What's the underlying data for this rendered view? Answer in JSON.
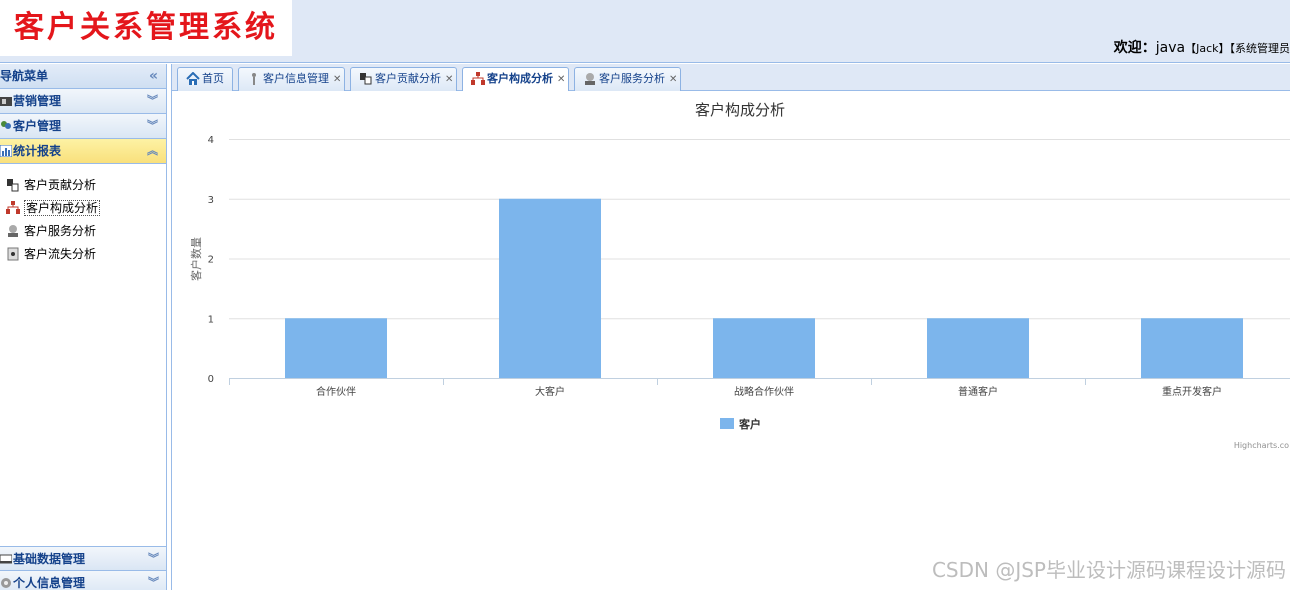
{
  "header": {
    "logo_text": "客户关系管理系统",
    "welcome_label": "欢迎：",
    "username": "java",
    "user_detail": "【Jack】【系统管理员"
  },
  "sidebar": {
    "title": "导航菜单",
    "collapse_glyph": "«",
    "groups_top": [
      {
        "label": "营销管理",
        "icon": "marketing-icon"
      },
      {
        "label": "客户管理",
        "icon": "customer-icon"
      }
    ],
    "active_group": {
      "label": "统计报表",
      "icon": "report-icon"
    },
    "items": [
      {
        "label": "客户贡献分析",
        "icon": "contribution-icon"
      },
      {
        "label": "客户构成分析",
        "icon": "composition-icon"
      },
      {
        "label": "客户服务分析",
        "icon": "service-icon"
      },
      {
        "label": "客户流失分析",
        "icon": "churn-icon"
      }
    ],
    "groups_bottom": [
      {
        "label": "基础数据管理",
        "icon": "basic-data-icon"
      },
      {
        "label": "个人信息管理",
        "icon": "personal-info-icon"
      }
    ]
  },
  "tabs": [
    {
      "label": "首页",
      "icon": "home-icon",
      "closable": false
    },
    {
      "label": "客户信息管理",
      "icon": "customer-info-icon",
      "closable": true
    },
    {
      "label": "客户贡献分析",
      "icon": "contribution-icon",
      "closable": true
    },
    {
      "label": "客户构成分析",
      "icon": "composition-icon",
      "closable": true,
      "active": true
    },
    {
      "label": "客户服务分析",
      "icon": "service-icon",
      "closable": true
    }
  ],
  "chart_data": {
    "type": "bar",
    "title": "客户构成分析",
    "categories": [
      "合作伙伴",
      "大客户",
      "战略合作伙伴",
      "普通客户",
      "重点开发客户"
    ],
    "series": [
      {
        "name": "客户",
        "values": [
          1,
          3,
          1,
          1,
          1
        ],
        "color": "#7cb5ec"
      }
    ],
    "ylabel": "客户数量",
    "xlabel": "",
    "ylim": [
      0,
      4
    ],
    "yticks": [
      "0",
      "1",
      "2",
      "3",
      "4"
    ],
    "grid": true,
    "legend": "bottom-center",
    "credits": "Highcharts.co"
  },
  "watermark": "CSDN @JSP毕业设计源码课程设计源码"
}
